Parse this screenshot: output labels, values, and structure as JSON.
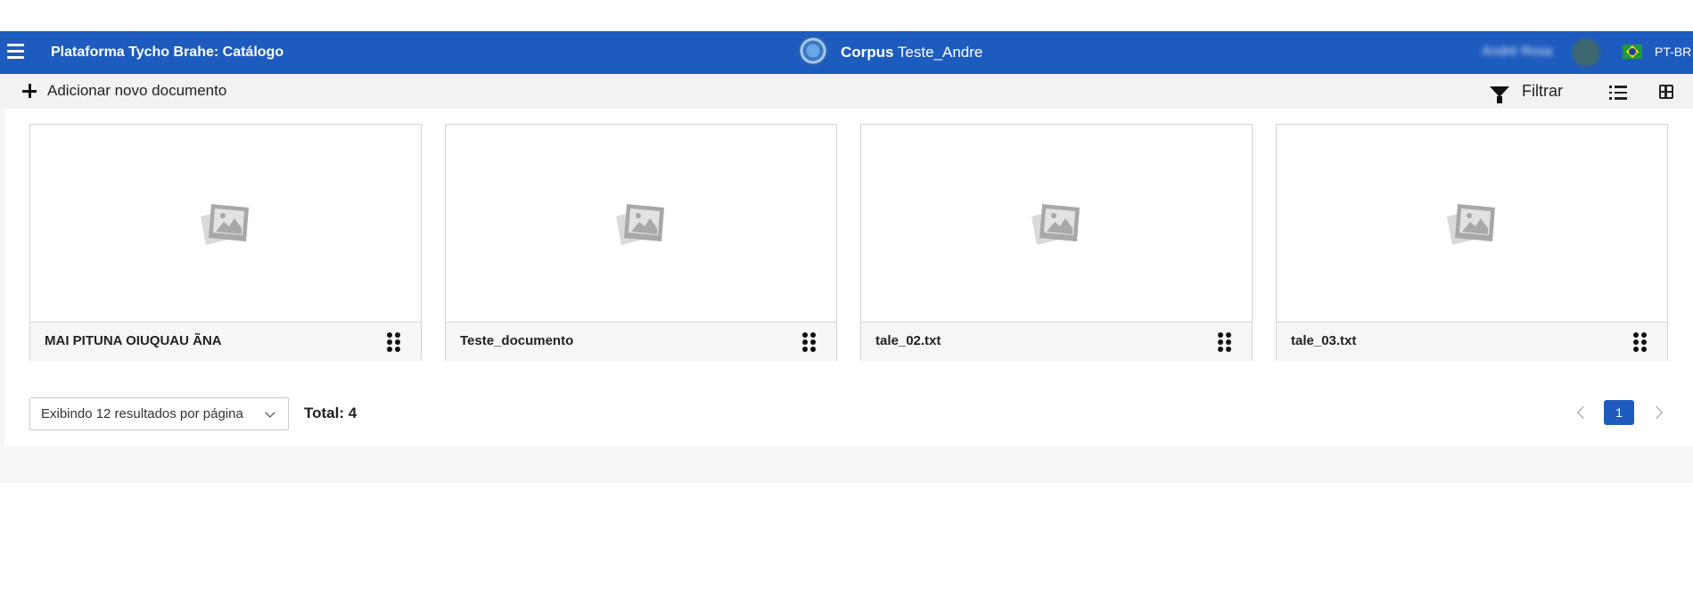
{
  "header": {
    "app_title": "Plataforma Tycho Brahe: Catálogo",
    "corpus_label": "Corpus",
    "corpus_name": "Teste_Andre",
    "user_name": "André Rosa",
    "language": "PT-BR",
    "bg_color": "#1d5bbf"
  },
  "toolbar": {
    "add_label": "Adicionar novo documento",
    "filter_label": "Filtrar"
  },
  "documents": [
    {
      "title": "MAI PITUNA OIUQUAU ÃNA"
    },
    {
      "title": "Teste_documento"
    },
    {
      "title": "tale_02.txt"
    },
    {
      "title": "tale_03.txt"
    }
  ],
  "footer": {
    "per_page_label": "Exibindo 12 resultados por página",
    "total_label": "Total: 4",
    "current_page": "1"
  },
  "icons": [
    "menu-icon",
    "plus-icon",
    "filter-icon",
    "list-view-icon",
    "grid-view-icon",
    "image-placeholder-icon",
    "drag-handle-icon",
    "chevron-down-icon",
    "chevron-left-icon",
    "chevron-right-icon"
  ]
}
